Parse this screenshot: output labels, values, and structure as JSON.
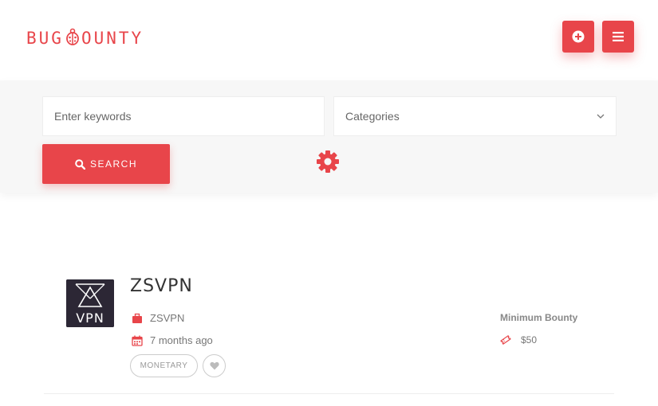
{
  "header": {
    "logo_prefix": "BUG ",
    "logo_suffix": "OUNTY",
    "brand_color": "#e8454a"
  },
  "search": {
    "keywords_placeholder": "Enter keywords",
    "categories_value": "Categories",
    "search_label": "Search"
  },
  "listing": {
    "title": "ZSVPN",
    "thumb_text": "VPN",
    "company": "ZSVPN",
    "posted": "7 months ago",
    "tag": "MONETARY",
    "bounty_label": "Minimum Bounty",
    "bounty_value": "$50"
  }
}
